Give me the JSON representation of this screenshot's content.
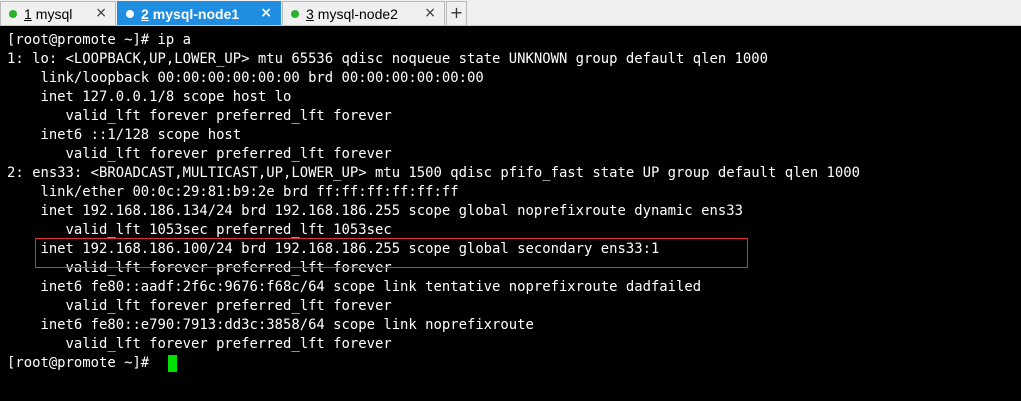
{
  "tabs": [
    {
      "number": "1",
      "label": "mysql",
      "active": false,
      "dot_color": "#2ab02a",
      "close": "×"
    },
    {
      "number": "2",
      "label": "mysql-node1",
      "active": true,
      "dot_color": "#ffffff",
      "close": "×"
    },
    {
      "number": "3",
      "label": "mysql-node2",
      "active": false,
      "dot_color": "#2ab02a",
      "close": "×"
    }
  ],
  "add_tab_label": "+",
  "terminal": {
    "lines": [
      "[root@promote ~]# ip a",
      "1: lo: <LOOPBACK,UP,LOWER_UP> mtu 65536 qdisc noqueue state UNKNOWN group default qlen 1000",
      "    link/loopback 00:00:00:00:00:00 brd 00:00:00:00:00:00",
      "    inet 127.0.0.1/8 scope host lo",
      "       valid_lft forever preferred_lft forever",
      "    inet6 ::1/128 scope host",
      "       valid_lft forever preferred_lft forever",
      "2: ens33: <BROADCAST,MULTICAST,UP,LOWER_UP> mtu 1500 qdisc pfifo_fast state UP group default qlen 1000",
      "    link/ether 00:0c:29:81:b9:2e brd ff:ff:ff:ff:ff:ff",
      "    inet 192.168.186.134/24 brd 192.168.186.255 scope global noprefixroute dynamic ens33",
      "       valid_lft 1053sec preferred_lft 1053sec",
      "    inet 192.168.186.100/24 brd 192.168.186.255 scope global secondary ens33:1",
      "       valid_lft forever preferred_lft forever",
      "    inet6 fe80::aadf:2f6c:9676:f68c/64 scope link tentative noprefixroute dadfailed",
      "       valid_lft forever preferred_lft forever",
      "    inet6 fe80::e790:7913:dd3c:3858/64 scope link noprefixroute",
      "       valid_lft forever preferred_lft forever",
      "[root@promote ~]# "
    ],
    "text_color": "#ffffff",
    "background": "#000000",
    "cursor_color": "#00e000",
    "highlight_color": "#e03030"
  }
}
